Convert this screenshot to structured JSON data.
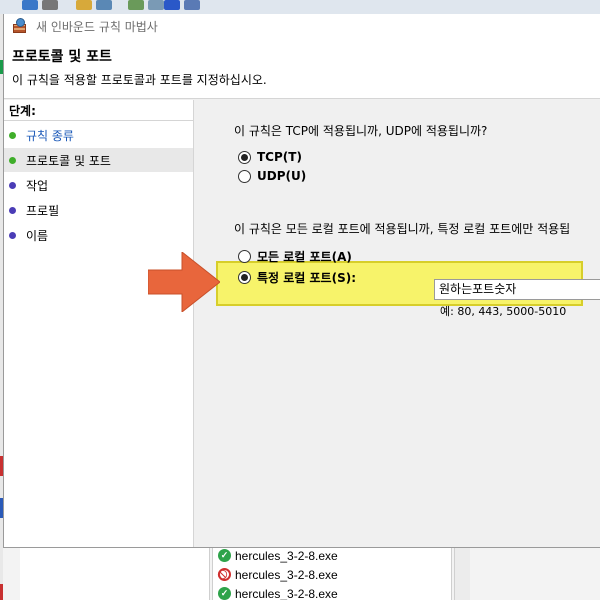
{
  "wizard": {
    "title": "새 인바운드 규칙 마법사",
    "header_title": "프로토콜 및 포트",
    "header_desc": "이 규칙을 적용할 프로토콜과 포트를 지정하십시오."
  },
  "steps": {
    "label": "단계:",
    "items": [
      {
        "label": "규칙 종류",
        "state": "done",
        "color": "#3fae2a"
      },
      {
        "label": "프로토콜 및 포트",
        "state": "current",
        "color": "#3fae2a"
      },
      {
        "label": "작업",
        "state": "pending",
        "color": "#4a3cb6"
      },
      {
        "label": "프로필",
        "state": "pending",
        "color": "#4a3cb6"
      },
      {
        "label": "이름",
        "state": "pending",
        "color": "#4a3cb6"
      }
    ]
  },
  "content": {
    "protocol_question": "이 규칙은 TCP에 적용됩니까, UDP에 적용됩니까?",
    "tcp_label": "TCP(T)",
    "udp_label": "UDP(U)",
    "protocol_selected": "TCP(T)",
    "port_question": "이 규칙은 모든 로컬 포트에 적용됩니까, 특정 로컬 포트에만 적용됩",
    "all_ports_label": "모든 로컬 포트(A)",
    "specific_ports_label": "특정 로컬 포트(S):",
    "port_selected": "특정 로컬 포트(S):",
    "port_value": "원하는포트숫자",
    "port_example": "예: 80, 443, 5000-5010"
  },
  "background_files": [
    {
      "name": "hercules_3-2-8.exe",
      "status": "allowed"
    },
    {
      "name": "hercules_3-2-8.exe",
      "status": "blocked"
    },
    {
      "name": "hercules_3-2-8.exe",
      "status": "allowed"
    }
  ],
  "colors": {
    "highlight": "#f7f36a",
    "arrow": "#e8663c",
    "step_done_text": "#1a58b8"
  }
}
